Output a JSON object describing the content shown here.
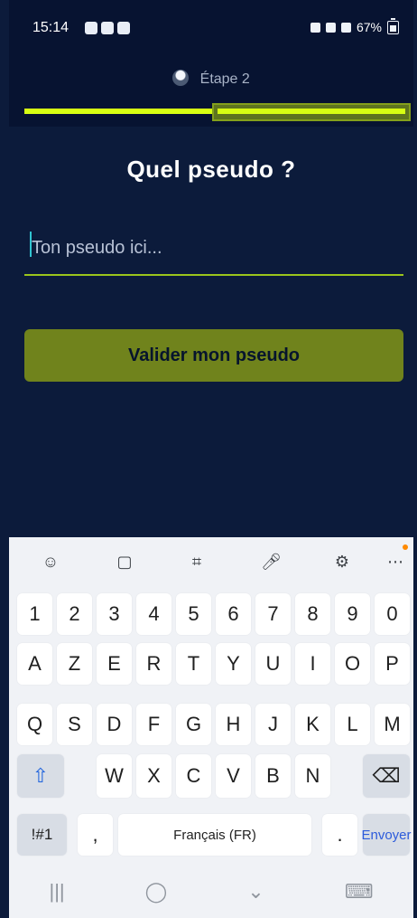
{
  "status": {
    "time": "15:14",
    "battery": "67%"
  },
  "header": {
    "stage": "Étape 2"
  },
  "screen": {
    "title": "Quel pseudo ?",
    "input_placeholder": "Ton pseudo ici...",
    "button_label": "Valider mon pseudo"
  },
  "keyboard": {
    "toolbar": [
      "emoji-icon",
      "clipboard-icon",
      "sticker-icon",
      "microphone-icon",
      "settings-icon",
      "more-icon"
    ],
    "row1": [
      "1",
      "2",
      "3",
      "4",
      "5",
      "6",
      "7",
      "8",
      "9",
      "0"
    ],
    "row2": [
      "A",
      "Z",
      "E",
      "R",
      "T",
      "Y",
      "U",
      "I",
      "O",
      "P"
    ],
    "row3": [
      "Q",
      "S",
      "D",
      "F",
      "G",
      "H",
      "J",
      "K",
      "L",
      "M"
    ],
    "row4": [
      "W",
      "X",
      "C",
      "V",
      "B",
      "N"
    ],
    "symbols": "!#1",
    "comma": ",",
    "space": "Français (FR)",
    "period": ".",
    "enter": "Envoyer"
  },
  "nav": {
    "back": "|||",
    "home": "◯",
    "recent": "⌄",
    "keyboard": "⌨"
  }
}
